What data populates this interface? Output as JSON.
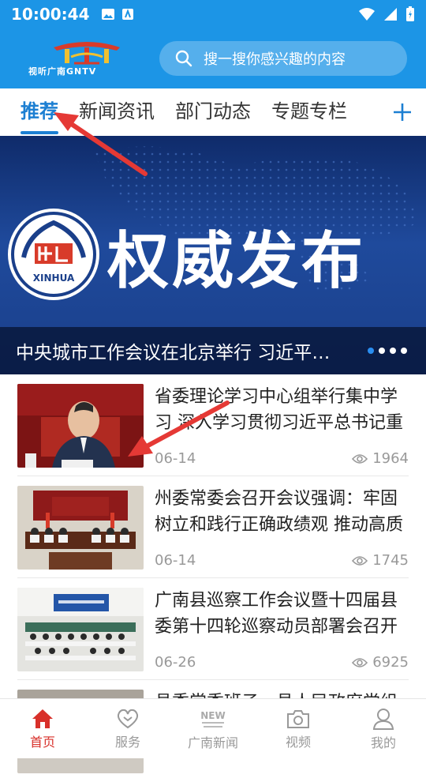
{
  "status_bar": {
    "time": "10:00:44"
  },
  "header": {
    "logo_text": "视听广南GNTV",
    "search_placeholder": "搜一搜你感兴趣的内容"
  },
  "tabs": [
    {
      "label": "推荐",
      "active": true
    },
    {
      "label": "新闻资讯",
      "active": false
    },
    {
      "label": "部门动态",
      "active": false
    },
    {
      "label": "专题专栏",
      "active": false
    }
  ],
  "tab_add_label": "+",
  "banner": {
    "title": "权威发布",
    "seal_text": "XINHUA",
    "caption": "中央城市工作会议在北京举行  习近平发表重要讲话",
    "page_count": 4,
    "current_page": 1
  },
  "news": [
    {
      "title": "省委理论学习中心组举行集中学习 深入学习贯彻习近平总书记重要讲话精神",
      "date": "06-14",
      "views": "1964"
    },
    {
      "title": "州委常委会召开会议强调：牢固树立和践行正确政绩观 推动高质量发展",
      "date": "06-14",
      "views": "1745"
    },
    {
      "title": "广南县巡察工作会议暨十四届县委第十四轮巡察动员部署会召开",
      "date": "06-26",
      "views": "6925"
    },
    {
      "title": "县委常委班子、县人民政府党组",
      "date": "",
      "views": ""
    }
  ],
  "tabbar": [
    {
      "label": "首页",
      "icon": "home-icon",
      "active": true
    },
    {
      "label": "服务",
      "icon": "heart-icon",
      "active": false
    },
    {
      "label": "广南新闻",
      "icon": "news-icon",
      "active": false
    },
    {
      "label": "视频",
      "icon": "camera-icon",
      "active": false
    },
    {
      "label": "我的",
      "icon": "user-icon",
      "active": false
    }
  ],
  "colors": {
    "brand": "#1c95e6",
    "tab_active": "#1c7fd2",
    "tabbar_active": "#d8302a",
    "annotation": "#e53935"
  }
}
